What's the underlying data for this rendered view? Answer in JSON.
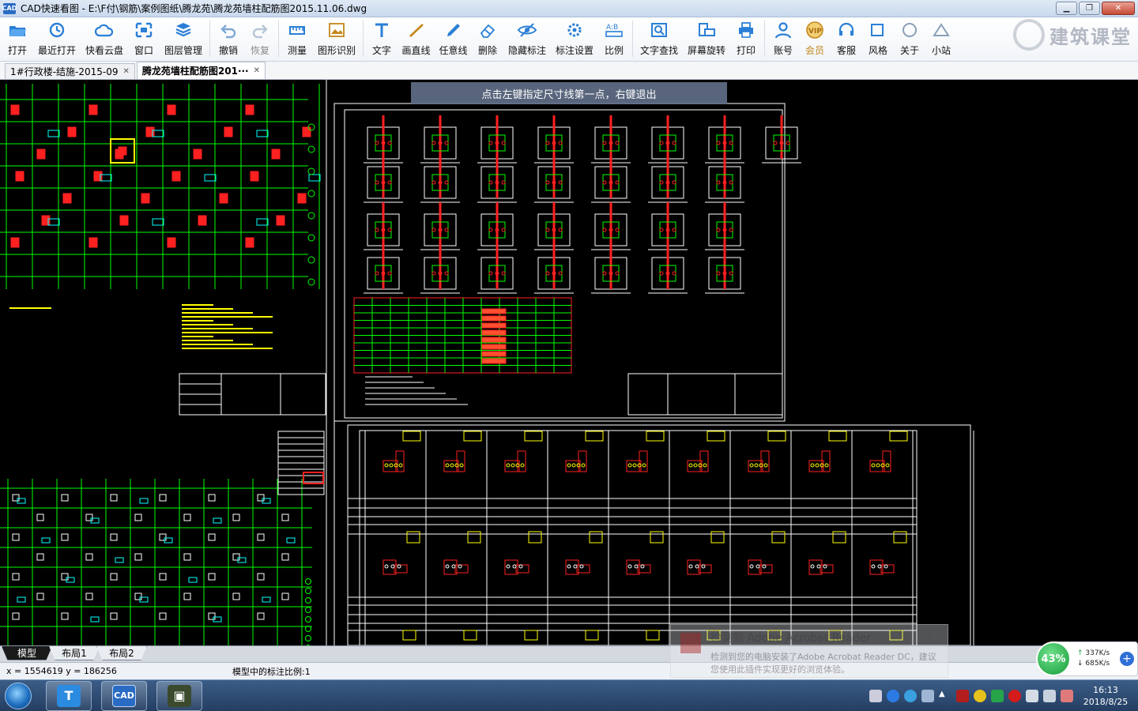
{
  "window": {
    "title": "CAD快速看图 - E:\\F付\\钢筋\\案例图纸\\腾龙苑\\腾龙苑墙柱配筋图2015.11.06.dwg",
    "app_icon": "CAD"
  },
  "toolbar": {
    "items": [
      {
        "label": "打开",
        "icon": "open-folder-icon"
      },
      {
        "label": "最近打开",
        "icon": "recent-open-icon"
      },
      {
        "label": "快看云盘",
        "icon": "cloud-drive-icon"
      },
      {
        "label": "窗口",
        "icon": "window-icon"
      },
      {
        "label": "图层管理",
        "icon": "layers-icon"
      },
      {
        "label": "撤销",
        "icon": "undo-icon"
      },
      {
        "label": "恢复",
        "icon": "redo-icon"
      },
      {
        "label": "测量",
        "icon": "measure-icon"
      },
      {
        "label": "图形识别",
        "icon": "shape-recognition-icon"
      },
      {
        "label": "文字",
        "icon": "text-icon"
      },
      {
        "label": "画直线",
        "icon": "draw-line-icon"
      },
      {
        "label": "任意线",
        "icon": "freehand-line-icon"
      },
      {
        "label": "删除",
        "icon": "eraser-icon"
      },
      {
        "label": "隐藏标注",
        "icon": "hide-annotation-icon"
      },
      {
        "label": "标注设置",
        "icon": "annotation-settings-icon"
      },
      {
        "label": "比例",
        "icon": "scale-icon"
      },
      {
        "label": "文字查找",
        "icon": "text-search-icon"
      },
      {
        "label": "屏幕旋转",
        "icon": "screen-rotate-icon"
      },
      {
        "label": "打印",
        "icon": "print-icon"
      },
      {
        "label": "账号",
        "icon": "account-icon"
      },
      {
        "label": "会员",
        "icon": "vip-icon"
      },
      {
        "label": "客服",
        "icon": "customer-service-icon"
      },
      {
        "label": "风格",
        "icon": "style-icon"
      },
      {
        "label": "关于",
        "icon": "about-icon"
      },
      {
        "label": "小站",
        "icon": "station-icon"
      }
    ],
    "brand_text": "建筑课堂"
  },
  "tabs": [
    {
      "label": "1#行政楼-结施-2015-09",
      "active": false
    },
    {
      "label": "腾龙苑墙柱配筋图201···",
      "active": true
    }
  ],
  "canvas": {
    "hint": "点击左键指定尺寸线第一点，右键退出",
    "colors": {
      "grid": "#00ff00",
      "frame": "#ffffff",
      "rebar": "#ff2020",
      "annotation": "#ffff00",
      "detail": "#00ffff"
    }
  },
  "layout_tabs": [
    {
      "label": "模型",
      "active": true
    },
    {
      "label": "布局1",
      "active": false
    },
    {
      "label": "布局2",
      "active": false
    }
  ],
  "status": {
    "coords": "x = 1554619  y = 186256",
    "scale_text": "模型中的标注比例:1"
  },
  "network": {
    "percent": "43%",
    "up": "337K/s",
    "down": "685K/s"
  },
  "notification": {
    "title": "检测到 Adobe Acrobat Reader",
    "body_line1": "检测到您的电脑安装了Adobe Acrobat Reader DC，建议",
    "body_line2": "您使用此插件实现更好的浏览体验。"
  },
  "taskbar": {
    "clock_time": "16:13",
    "clock_date": "2018/8/25"
  }
}
